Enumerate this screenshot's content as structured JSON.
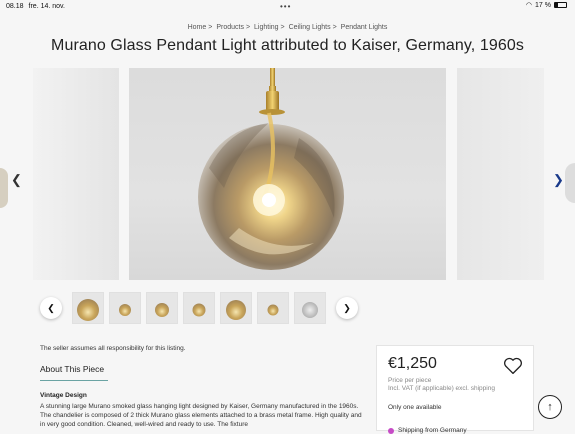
{
  "status": {
    "time": "08.18",
    "date": "fre. 14. nov.",
    "battery": "17 %"
  },
  "breadcrumb": [
    "Home",
    "Products",
    "Lighting",
    "Ceiling Lights",
    "Pendant Lights"
  ],
  "breadcrumb_separator": ">",
  "title": "Murano Glass Pendant Light attributed to Kaiser, Germany, 1960s",
  "gallery": {
    "prev_icon": "chevron-left-icon",
    "next_icon": "chevron-right-icon"
  },
  "thumbnails": [
    "thumb-1",
    "thumb-2",
    "thumb-3",
    "thumb-4",
    "thumb-5",
    "thumb-6",
    "thumb-7"
  ],
  "seller_note": "The seller assumes all responsibility for this listing.",
  "about_heading": "About This Piece",
  "vintage_label": "Vintage Design",
  "description": "A stunning large Murano smoked glass hanging light designed by Kaiser, Germany manufactured in the 1960s. The chandelier is composed of 2 thick Murano glass elements attached to a brass metal frame. High quality and in very good condition. Cleaned, well-wired and ready to use. The fixture",
  "price_card": {
    "price": "€1,250",
    "per_piece": "Price per piece",
    "vat": "Incl. VAT (if applicable) excl. shipping",
    "availability": "Only one available",
    "shipping": "Shipping from Germany"
  },
  "colors": {
    "accent_line": "#6aa3a3",
    "nav_arrow": "#1a3a8a",
    "shipping_dot": "#c64bc6"
  }
}
